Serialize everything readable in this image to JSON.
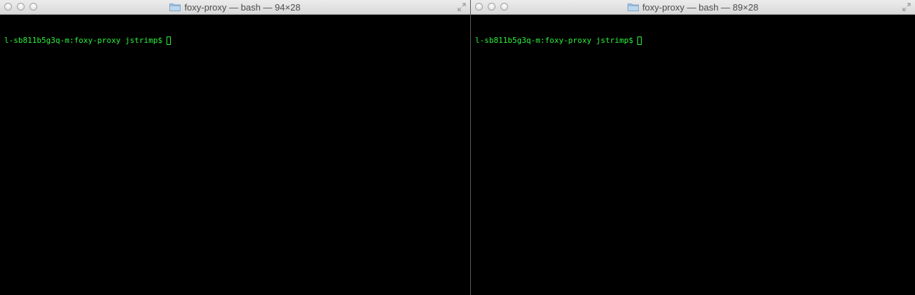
{
  "windows": [
    {
      "title": "foxy-proxy — bash — 94×28",
      "prompt": "l-sb811b5g3q-m:foxy-proxy jstrimp$"
    },
    {
      "title": "foxy-proxy — bash — 89×28",
      "prompt": "l-sb811b5g3q-m:foxy-proxy jstrimp$"
    }
  ],
  "colors": {
    "terminal_bg": "#000000",
    "prompt_text": "#2cf23d",
    "titlebar": "#e3e3e3"
  },
  "icons": {
    "title_icon": "folder-icon",
    "window_buttons": [
      "close-button",
      "minimize-button",
      "zoom-button"
    ],
    "corner": "fullscreen-icon"
  }
}
